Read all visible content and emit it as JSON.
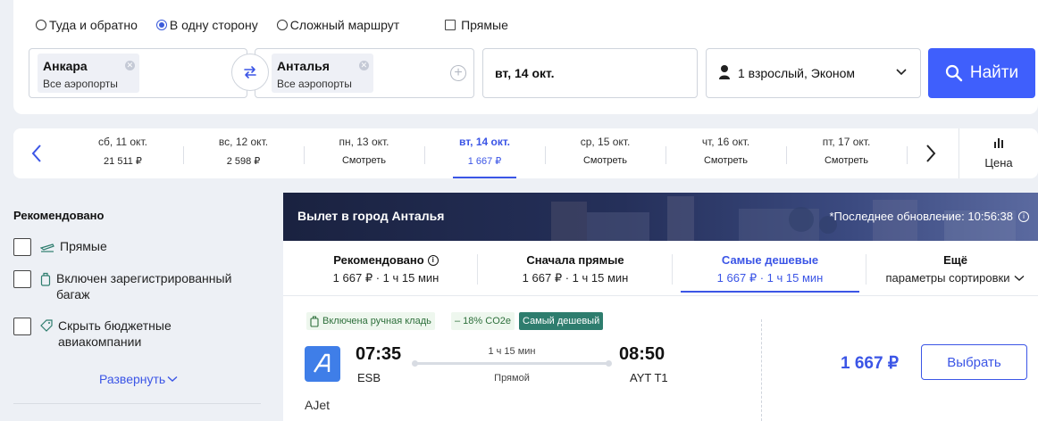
{
  "trip_type": {
    "options": [
      "Туда и обратно",
      "В одну сторону",
      "Сложный маршрут"
    ],
    "selected_index": 1,
    "direct_label": "Прямые"
  },
  "from": {
    "city": "Анкара",
    "sub": "Все аэропорты"
  },
  "to": {
    "city": "Анталья",
    "sub": "Все аэропорты"
  },
  "date_field": "вт, 14 окт.",
  "passengers": "1 взрослый, Эконом",
  "search_label": "Найти",
  "date_strip": {
    "days": [
      {
        "label": "сб, 11 окт.",
        "price": "21 511 ₽"
      },
      {
        "label": "вс, 12 окт.",
        "price": "2 598 ₽"
      },
      {
        "label": "пн, 13 окт.",
        "price": "Смотреть"
      },
      {
        "label": "вт, 14 окт.",
        "price": "1 667 ₽",
        "active": true
      },
      {
        "label": "ср, 15 окт.",
        "price": "Смотреть"
      },
      {
        "label": "чт, 16 окт.",
        "price": "Смотреть"
      },
      {
        "label": "пт, 17 окт.",
        "price": "Смотреть"
      }
    ],
    "price_graph_label": "Цена"
  },
  "filters": {
    "title": "Рекомендовано",
    "items": [
      {
        "label": "Прямые",
        "icon": "plane-icon"
      },
      {
        "label": "Включен зарегистрированный багаж",
        "icon": "baggage-icon"
      },
      {
        "label": "Скрыть бюджетные авиакомпании",
        "icon": "tag-icon"
      }
    ],
    "expand_label": "Развернуть"
  },
  "banner": {
    "title": "Вылет в город Анталья",
    "updated": "*Последнее обновление: 10:56:38"
  },
  "sort_tabs": [
    {
      "title": "Рекомендовано",
      "sub": "1 667 ₽ · 1 ч 15 мин"
    },
    {
      "title": "Сначала прямые",
      "sub": "1 667 ₽ · 1 ч 15 мин"
    },
    {
      "title": "Самые дешевые",
      "sub": "1 667 ₽ · 1 ч 15 мин",
      "active": true
    },
    {
      "title": "Ещё",
      "sub": "параметры сортировки"
    }
  ],
  "ticket": {
    "tags": {
      "bag": "Включена ручная кладь",
      "co2": "– 18% CO2e",
      "cheap": "Самый дешевый"
    },
    "airline": "AJet",
    "dep_time": "07:35",
    "dep_code": "ESB",
    "arr_time": "08:50",
    "arr_code": "AYT T1",
    "duration": "1 ч 15 мин",
    "stops": "Прямой",
    "price": "1 667 ₽",
    "select_label": "Выбрать"
  },
  "colors": {
    "accent": "#3f5ffc",
    "link": "#3b55e6",
    "cheap_tag": "#2e7d6e",
    "airline_logo": "#3f7ee8"
  }
}
